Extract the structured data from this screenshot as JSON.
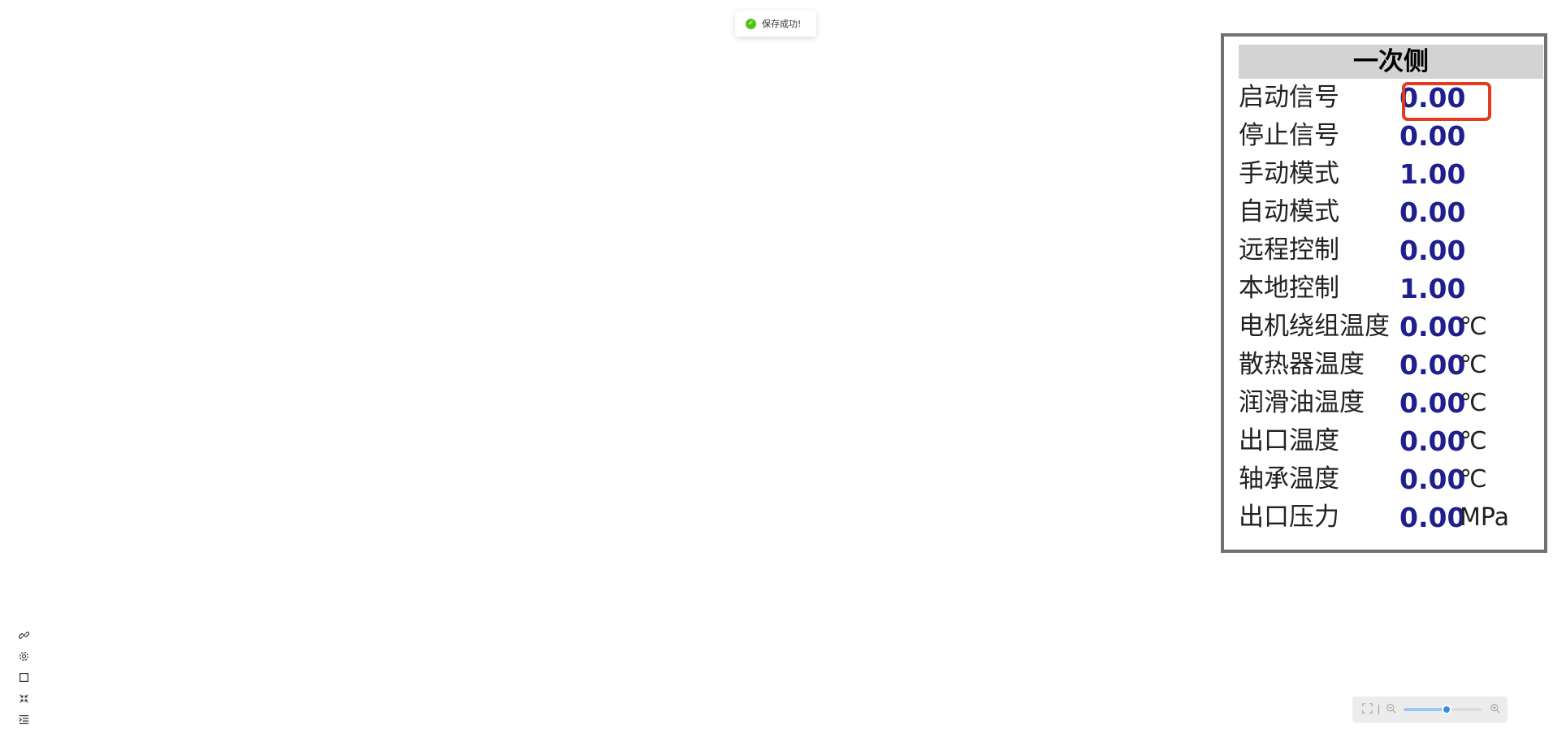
{
  "toast": {
    "icon": "success-check-icon",
    "message": "保存成功!"
  },
  "panel": {
    "title": "一次侧",
    "rows": [
      {
        "label": "启动信号",
        "value": "0.00",
        "unit": ""
      },
      {
        "label": "停止信号",
        "value": "0.00",
        "unit": ""
      },
      {
        "label": "手动模式",
        "value": "1.00",
        "unit": ""
      },
      {
        "label": "自动模式",
        "value": "0.00",
        "unit": ""
      },
      {
        "label": "远程控制",
        "value": "0.00",
        "unit": ""
      },
      {
        "label": "本地控制",
        "value": "1.00",
        "unit": ""
      },
      {
        "label": "电机绕组温度",
        "value": "0.00",
        "unit": "℃"
      },
      {
        "label": "散热器温度",
        "value": "0.00",
        "unit": "℃"
      },
      {
        "label": "润滑油温度",
        "value": "0.00",
        "unit": "℃"
      },
      {
        "label": "出口温度",
        "value": "0.00",
        "unit": "℃"
      },
      {
        "label": "轴承温度",
        "value": "0.00",
        "unit": "℃"
      },
      {
        "label": "出口压力",
        "value": "0.00",
        "unit": "MPa"
      }
    ],
    "highlight_color": "#e23b1f",
    "value_color": "#1f1f8f"
  },
  "left_toolbar": [
    "link-icon",
    "gear-icon",
    "square-icon",
    "collapse-arrows-icon",
    "indent-list-icon"
  ],
  "zoom": {
    "level": 0.55,
    "icons": [
      "fullscreen-icon",
      "zoom-out-icon",
      "zoom-in-icon"
    ]
  }
}
